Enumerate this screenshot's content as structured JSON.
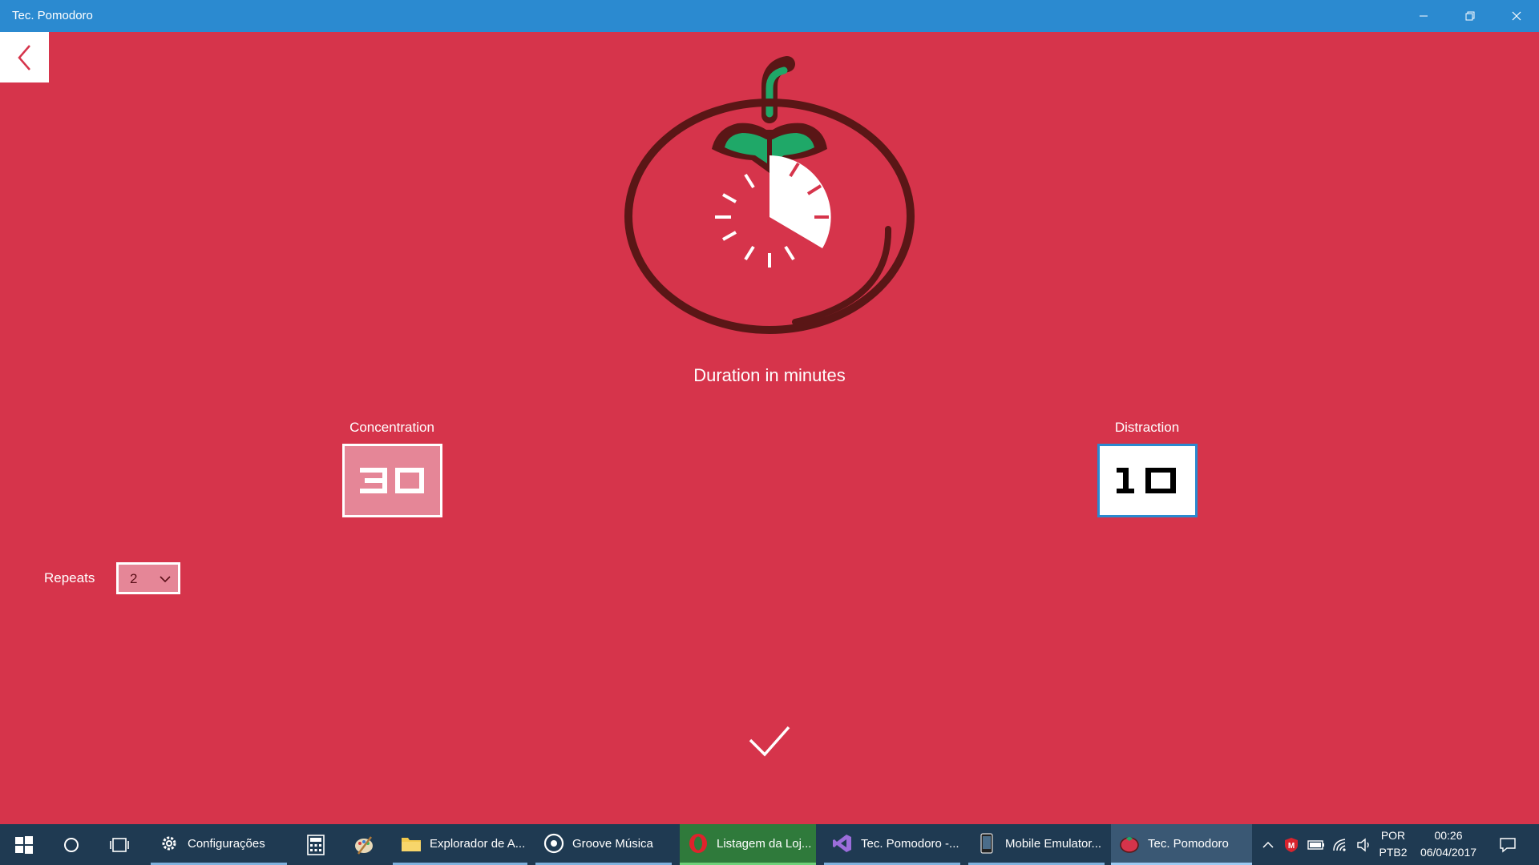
{
  "window": {
    "title": "Tec. Pomodoro"
  },
  "main": {
    "duration_label": "Duration in minutes",
    "concentration": {
      "label": "Concentration",
      "value": "30"
    },
    "distraction": {
      "label": "Distraction",
      "value": "10"
    },
    "repeats": {
      "label": "Repeats",
      "value": "2"
    }
  },
  "taskbar": {
    "apps": [
      {
        "label": "Configurações",
        "icon": "gear-icon"
      },
      {
        "label": "Explorador de A...",
        "icon": "folder-icon"
      },
      {
        "label": "Groove Música",
        "icon": "groove-icon"
      },
      {
        "label": "Listagem da Loj...",
        "icon": "opera-icon"
      },
      {
        "label": "Tec. Pomodoro -...",
        "icon": "visual-studio-icon"
      },
      {
        "label": "Mobile Emulator...",
        "icon": "phone-icon"
      },
      {
        "label": "Tec. Pomodoro",
        "icon": "tomato-icon"
      }
    ],
    "language": "POR",
    "layout": "PTB2",
    "time": "00:26",
    "date": "06/04/2017"
  },
  "colors": {
    "background": "#d6344b",
    "titlebar": "#2b8ad0",
    "taskbar": "#1f3a52",
    "tomato_outline": "#5a1616",
    "leaf": "#1fa868",
    "input_fill": "#e58697"
  }
}
